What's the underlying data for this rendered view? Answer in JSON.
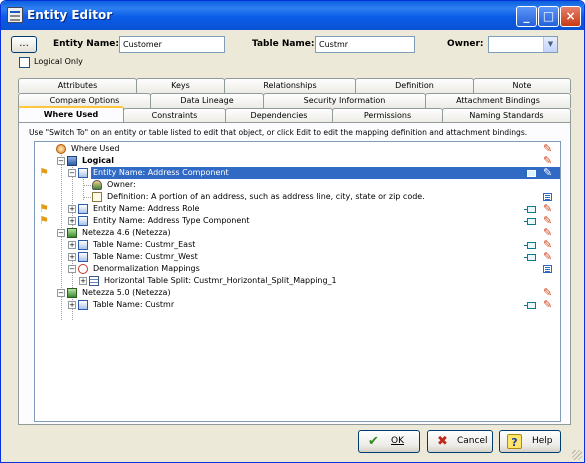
{
  "window": {
    "title": "Entity Editor",
    "minimize": "_",
    "maximize": "□",
    "close": "×"
  },
  "toprow": {
    "ellipsis": "...",
    "entity_name_label": "Entity Name:",
    "entity_name_value": "Customer",
    "table_name_label": "Table Name:",
    "table_name_value": "Custmr",
    "owner_label": "Owner:",
    "owner_value": ""
  },
  "logical_only": {
    "label": "Logical Only",
    "checked": false
  },
  "tabs": {
    "row1": [
      "Attributes",
      "Keys",
      "Relationships",
      "Definition",
      "Note"
    ],
    "row2": [
      "Compare Options",
      "Data Lineage",
      "Security Information",
      "Attachment Bindings"
    ],
    "row3": [
      "Where Used",
      "Constraints",
      "Dependencies",
      "Permissions",
      "Naming Standards"
    ],
    "active": "Where Used"
  },
  "instructions": "Use \"Switch To\" on an entity or table listed to edit that object, or click Edit to edit the mapping definition and attachment bindings.",
  "tree": [
    {
      "label": "Where Used",
      "icon": "where-used-icon"
    },
    {
      "label": "Logical",
      "icon": "logical-model-icon"
    },
    {
      "label": "Entity Name: Address Component",
      "icon": "entity-icon"
    },
    {
      "label": "Owner:",
      "icon": "owner-icon"
    },
    {
      "label": "Definition: A portion of an address, such as address line, city, state or zip code.",
      "icon": "definition-icon"
    },
    {
      "label": "Entity Name: Address Role",
      "icon": "entity-icon"
    },
    {
      "label": "Entity Name: Address Type Component",
      "icon": "entity-icon"
    },
    {
      "label": "Netezza 4.6 (Netezza)",
      "icon": "physical-model-icon"
    },
    {
      "label": "Table Name: Custmr_East",
      "icon": "table-icon"
    },
    {
      "label": "Table Name: Custmr_West",
      "icon": "table-icon"
    },
    {
      "label": "Denormalization Mappings",
      "icon": "denormalization-icon"
    },
    {
      "label": "Horizontal Table Split: Custmr_Horizontal_Split_Mapping_1",
      "icon": "split-icon"
    },
    {
      "label": "Netezza 5.0 (Netezza)",
      "icon": "physical-model-icon"
    },
    {
      "label": "Table Name: Custmr",
      "icon": "table-icon"
    }
  ],
  "buttons": {
    "ok": "OK",
    "cancel": "Cancel",
    "help": "Help"
  },
  "colors": {
    "selection": "#316ac5",
    "titlebar": "#0a5ce8",
    "tab_highlight": "#ffc83c",
    "edit_pencil": "#d2451d"
  }
}
